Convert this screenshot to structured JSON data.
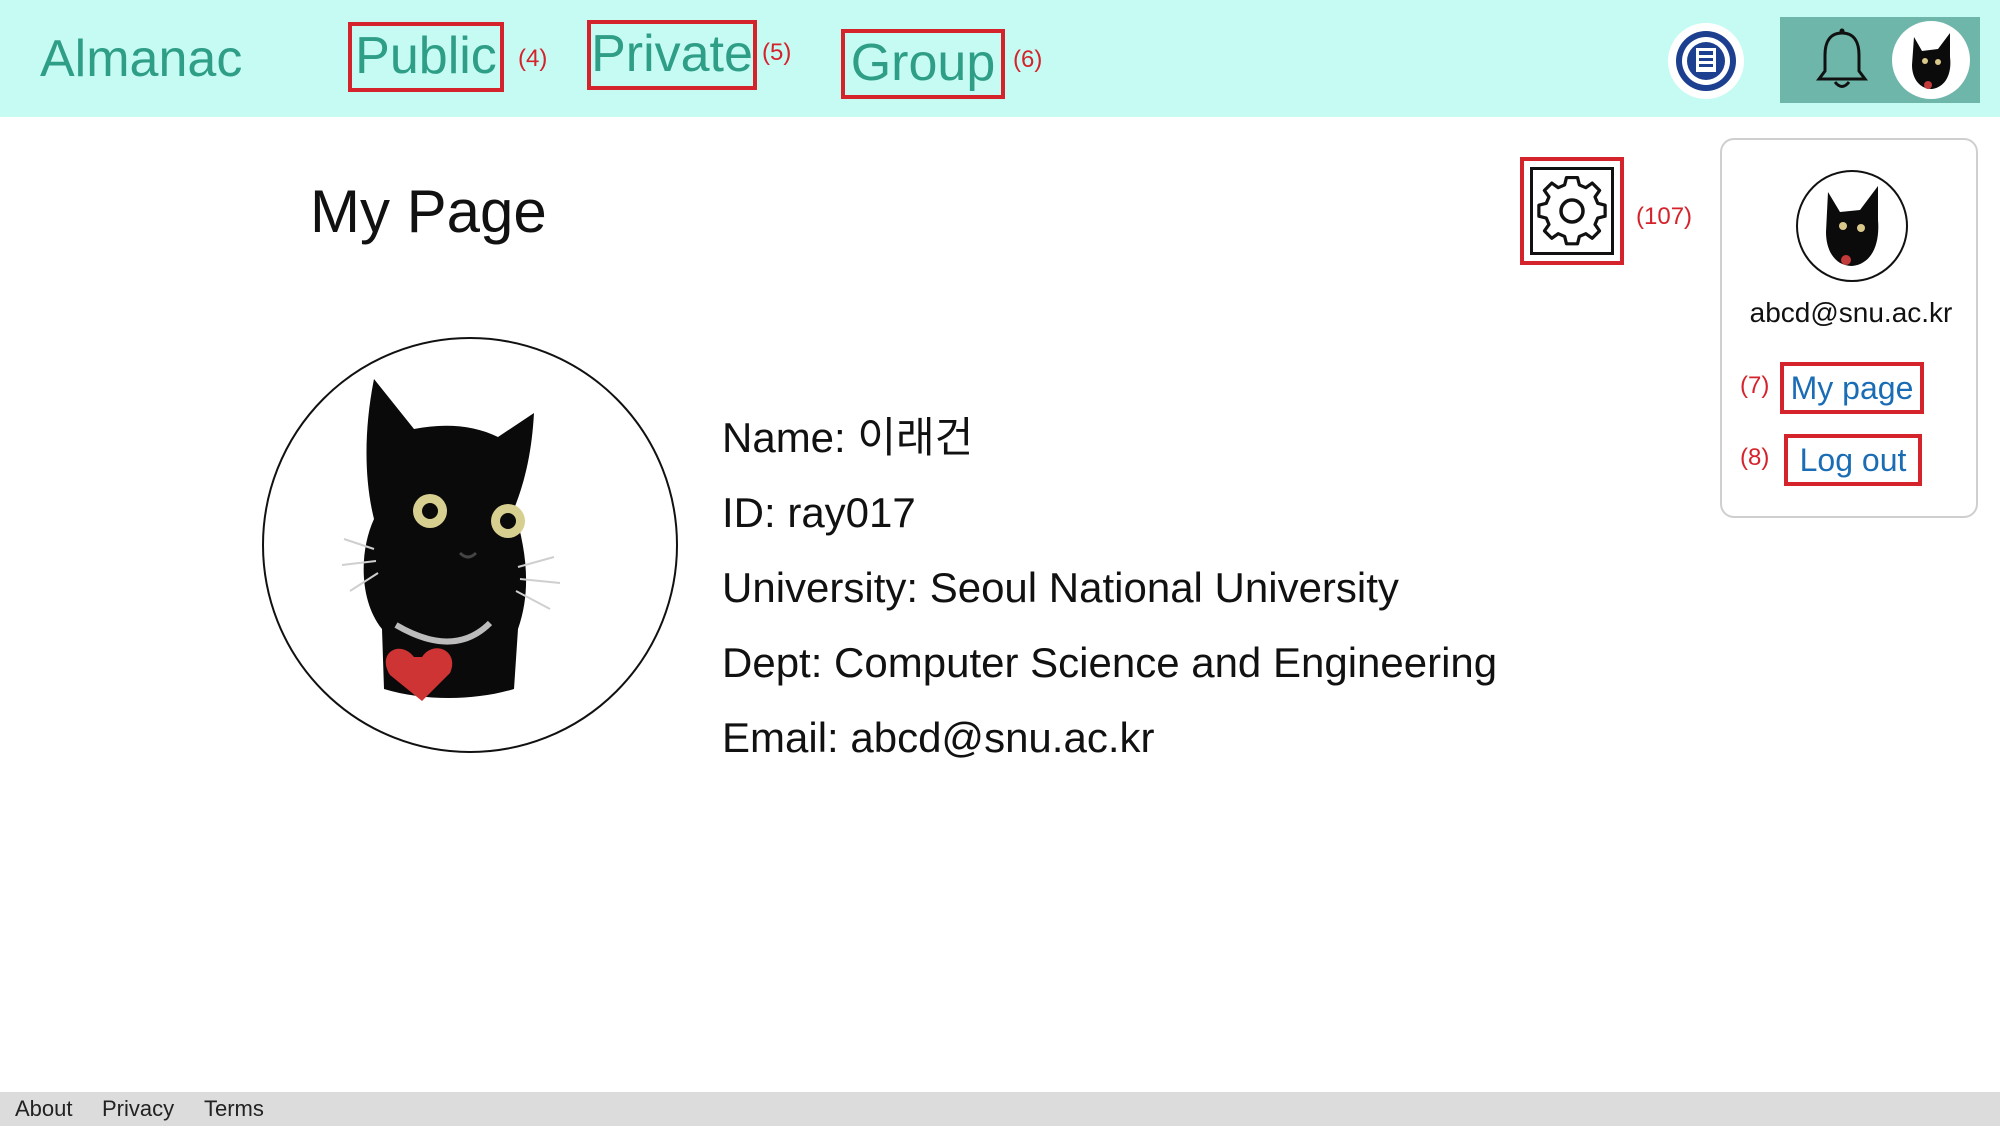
{
  "header": {
    "brand": "Almanac",
    "nav": [
      {
        "label": "Public",
        "tag": "(4)"
      },
      {
        "label": "Private",
        "tag": "(5)"
      },
      {
        "label": "Group",
        "tag": "(6)"
      }
    ],
    "icons": {
      "logo": "university-logo-icon",
      "notifications": "bell-icon",
      "avatar": "black-cat-avatar"
    }
  },
  "main": {
    "title": "My Page",
    "settings_tag": "(107)",
    "profile": {
      "name": "Name: 이래건",
      "id": "ID: ray017",
      "university": "University: Seoul National University",
      "dept": "Dept: Computer Science and Engineering",
      "email": "Email: abcd@snu.ac.kr"
    }
  },
  "dropdown": {
    "email": "abcd@snu.ac.kr",
    "items": [
      {
        "label": "My page",
        "tag": "(7)"
      },
      {
        "label": "Log out",
        "tag": "(8)"
      }
    ]
  },
  "footer": {
    "links": [
      "About",
      "Privacy",
      "Terms"
    ]
  },
  "colors": {
    "topbar_bg": "#c6fbf4",
    "brand_teal": "#2f9e87",
    "highlight_red": "#d4232b",
    "link_blue": "#1a6db5",
    "user_box_bg": "#6fb6aa",
    "footer_bg": "#dcdcdc"
  }
}
